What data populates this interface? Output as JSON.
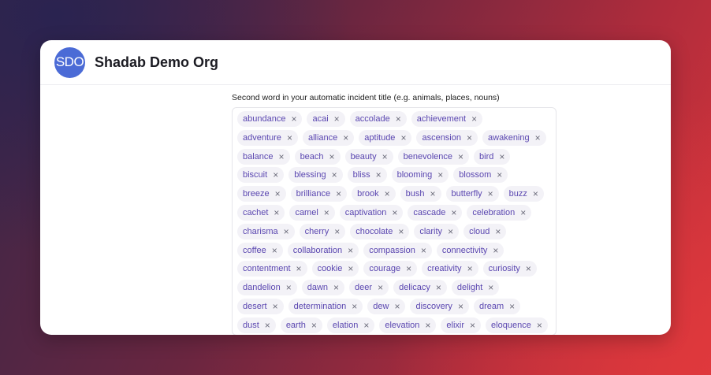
{
  "org": {
    "avatar_initials": "SDO",
    "name": "Shadab Demo Org"
  },
  "field": {
    "label": "Second word in your automatic incident title (e.g. animals, places, nouns)",
    "remove_glyph": "×",
    "chip_rows": [
      [
        "abundance",
        "acai",
        "accolade",
        "achievement"
      ],
      [
        "adventure",
        "alliance",
        "aptitude",
        "ascension",
        "awakening"
      ],
      [
        "balance",
        "beach",
        "beauty",
        "benevolence",
        "bird"
      ],
      [
        "biscuit",
        "blessing",
        "bliss",
        "blooming",
        "blossom"
      ],
      [
        "breeze",
        "brilliance",
        "brook",
        "bush",
        "butterfly",
        "buzz"
      ],
      [
        "cachet",
        "camel",
        "captivation",
        "cascade",
        "celebration"
      ],
      [
        "charisma",
        "cherry",
        "chocolate",
        "clarity",
        "cloud"
      ],
      [
        "coffee",
        "collaboration",
        "compassion",
        "connectivity"
      ],
      [
        "contentment",
        "cookie",
        "courage",
        "creativity",
        "curiosity"
      ],
      [
        "dandelion",
        "dawn",
        "deer",
        "delicacy",
        "delight"
      ],
      [
        "desert",
        "determination",
        "dew",
        "discovery",
        "dream"
      ],
      [
        "dust",
        "earth",
        "elation",
        "elevation",
        "elixir",
        "eloquence"
      ]
    ]
  },
  "colors": {
    "accent": "#5a46b0",
    "avatar": "#4b6bd6",
    "chip_bg": "#f3f2f7"
  }
}
